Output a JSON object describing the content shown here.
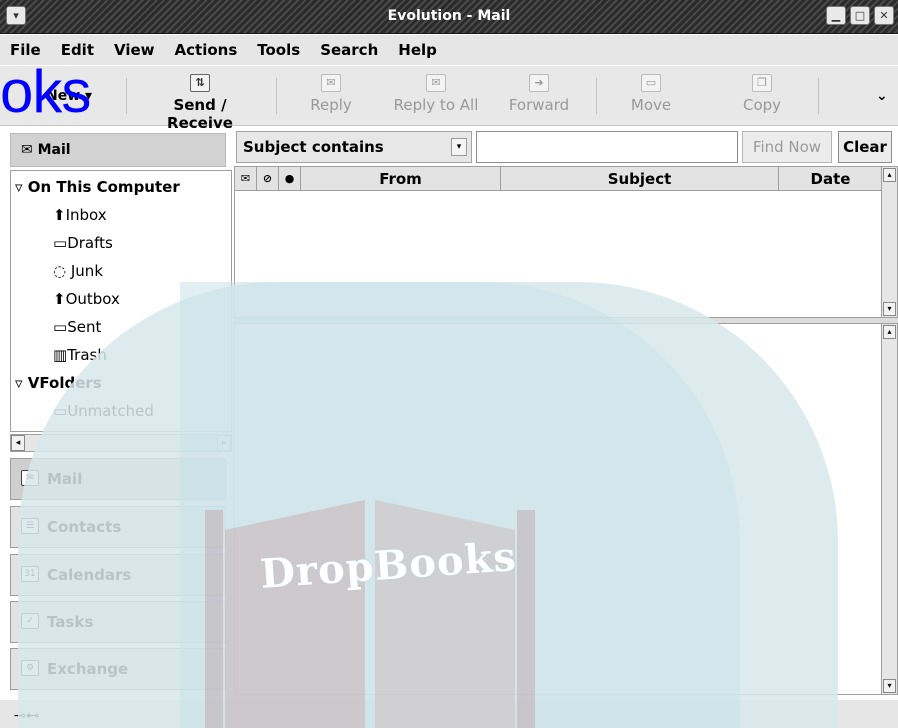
{
  "window": {
    "title": "Evolution - Mail"
  },
  "menu": [
    "File",
    "Edit",
    "View",
    "Actions",
    "Tools",
    "Search",
    "Help"
  ],
  "toolbar": {
    "new_label": "New",
    "send_receive": "Send / Receive",
    "reply": "Reply",
    "reply_all": "Reply to All",
    "forward": "Forward",
    "move": "Move",
    "copy": "Copy"
  },
  "sidebar": {
    "header": "Mail",
    "tree": {
      "group1": "On This Computer",
      "items1": [
        "Inbox",
        "Drafts",
        "Junk",
        "Outbox",
        "Sent",
        "Trash"
      ],
      "group2": "VFolders",
      "items2": [
        "Unmatched"
      ]
    },
    "nav": [
      "Mail",
      "Contacts",
      "Calendars",
      "Tasks",
      "Exchange"
    ]
  },
  "search": {
    "mode": "Subject contains",
    "value": "",
    "find_now": "Find Now",
    "clear": "Clear"
  },
  "message_list": {
    "columns": [
      "From",
      "Subject",
      "Date"
    ]
  },
  "watermark": {
    "text": "DropBooks",
    "logo_fragment": "oks"
  }
}
